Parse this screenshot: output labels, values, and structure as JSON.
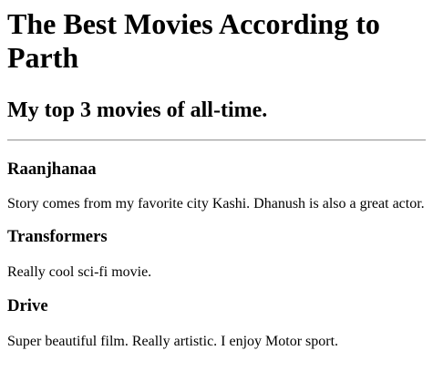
{
  "header": {
    "title": "The Best Movies According to Parth",
    "subtitle": "My top 3 movies of all-time."
  },
  "movies": [
    {
      "title": "Raanjhanaa",
      "description": "Story comes from my favorite city Kashi. Dhanush is also a great actor."
    },
    {
      "title": "Transformers",
      "description": "Really cool sci-fi movie."
    },
    {
      "title": "Drive",
      "description": "Super beautiful film. Really artistic. I enjoy Motor sport."
    }
  ]
}
